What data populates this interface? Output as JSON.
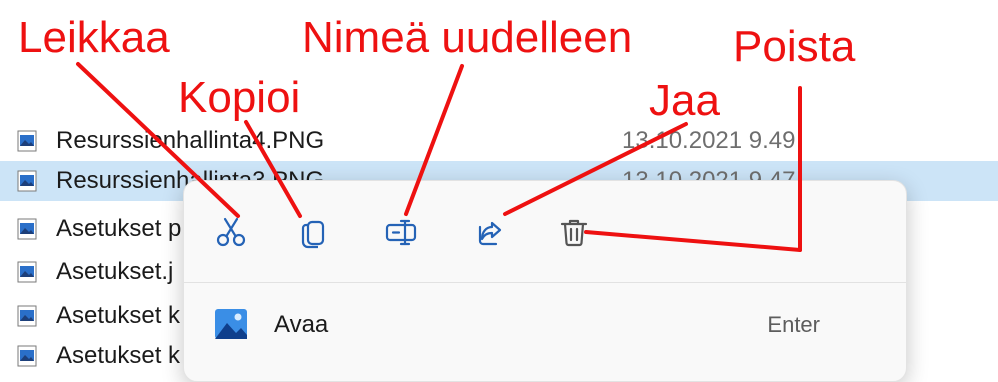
{
  "file_list": {
    "rows": [
      {
        "name": "Resurssienhallinta4.PNG",
        "date": "13.10.2021 9.49",
        "selected": false
      },
      {
        "name": "Resurssienhallinta3.PNG",
        "date": "13.10.2021 9.47",
        "selected": true
      },
      {
        "name": "Asetukset p",
        "date": "",
        "selected": false
      },
      {
        "name": "Asetukset.j",
        "date": "",
        "selected": false
      },
      {
        "name": "Asetukset k",
        "date": "",
        "selected": false
      },
      {
        "name": "Asetukset k",
        "date": "",
        "selected": false
      }
    ]
  },
  "context_menu": {
    "commands": [
      {
        "name": "cut",
        "icon": "scissors-icon"
      },
      {
        "name": "copy",
        "icon": "copy-icon"
      },
      {
        "name": "rename",
        "icon": "rename-icon"
      },
      {
        "name": "share",
        "icon": "share-icon"
      },
      {
        "name": "delete",
        "icon": "trash-icon"
      }
    ],
    "open_item": {
      "label": "Avaa",
      "shortcut": "Enter",
      "icon": "image-icon"
    }
  },
  "annotations": {
    "color": "#ee1111",
    "cut": "Leikkaa",
    "copy": "Kopioi",
    "rename": "Nimeä uudelleen",
    "share": "Jaa",
    "delete": "Poista"
  },
  "colors": {
    "selection": "#cce4f7",
    "icon_blue": "#2563b6",
    "annotation_red": "#ee1111"
  }
}
